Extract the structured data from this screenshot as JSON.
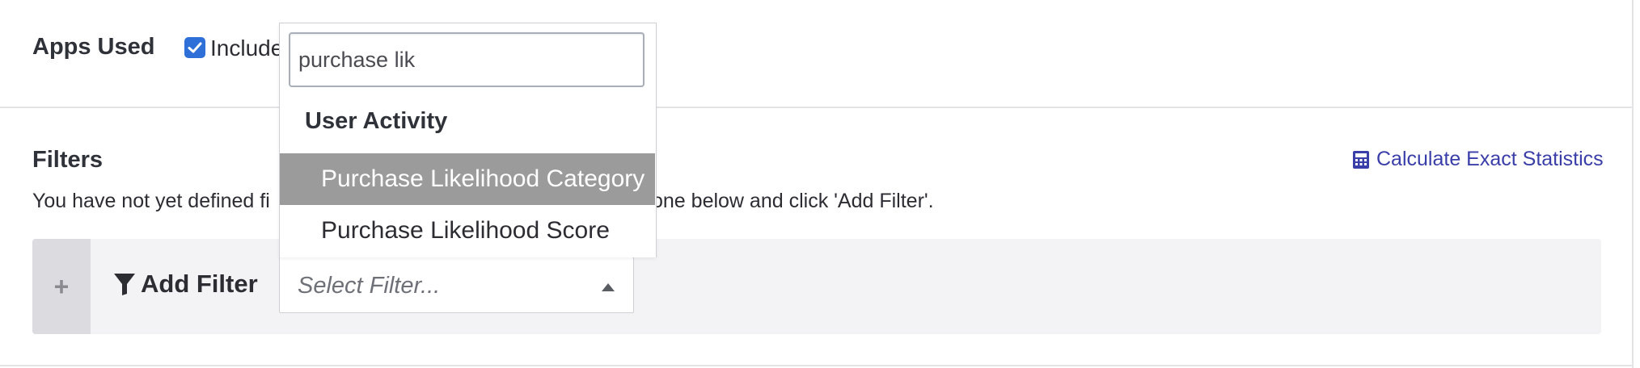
{
  "apps_used": {
    "title": "Apps Used",
    "checkbox_checked": true,
    "include_label": "Include"
  },
  "filters": {
    "title": "Filters",
    "calc_link": "Calculate Exact Statistics",
    "helper_text_left": "You have not yet defined fi",
    "helper_text_right": "select one below and click 'Add Filter'.",
    "add_filter_label": "Add Filter",
    "plus_label": "+",
    "select_placeholder": "Select Filter..."
  },
  "dropdown": {
    "search_value": "purchase lik",
    "group_label": "User Activity",
    "options": [
      {
        "label": "Purchase Likelihood Category",
        "highlighted": true
      },
      {
        "label": "Purchase Likelihood Score",
        "highlighted": false
      }
    ]
  },
  "icons": {
    "checkbox": "check-icon",
    "calc": "calculator-icon",
    "add_filter": "funnel-icon",
    "select_caret": "caret-up-icon",
    "plus": "plus-icon"
  },
  "colors": {
    "accent": "#2e6fd8",
    "link": "#3a3ea8",
    "highlight": "#9b9b9b",
    "bar_bg": "#f3f3f5"
  }
}
